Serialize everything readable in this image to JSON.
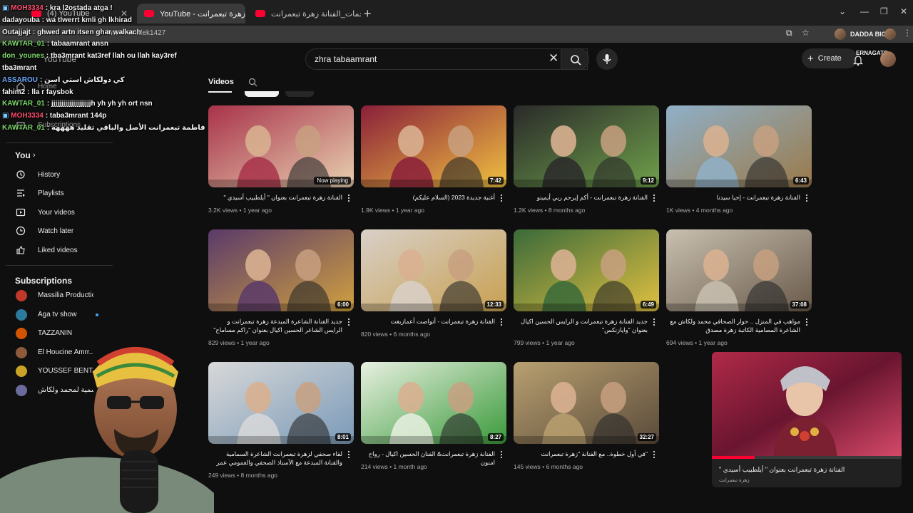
{
  "browser": {
    "tabs": [
      {
        "label": "(4) YouTube",
        "active": false
      },
      {
        "label": "YouTube - زهرة تبعمرانت",
        "active": true
      },
      {
        "label": "مع النجمات_الفنانة زهرة تبعمرانت",
        "active": false
      }
    ],
    "url": "hramossadek1427",
    "profile_name": "DADDA BIGA",
    "profile_name_2": "ERNAGATO"
  },
  "masthead": {
    "logo_text": "YouTube",
    "search_value": "zhra tabaamrant",
    "create_label": "Create"
  },
  "sidebar": {
    "top_items": [
      {
        "label": "Home",
        "icon": "home-icon"
      },
      {
        "label": "Subscriptions",
        "icon": "subscriptions-icon"
      }
    ],
    "you_label": "You",
    "you_items": [
      {
        "label": "History",
        "icon": "history-icon"
      },
      {
        "label": "Playlists",
        "icon": "playlists-icon"
      },
      {
        "label": "Your videos",
        "icon": "your-videos-icon"
      },
      {
        "label": "Watch later",
        "icon": "watch-later-icon"
      },
      {
        "label": "Liked videos",
        "icon": "liked-videos-icon"
      }
    ],
    "subscriptions_label": "Subscriptions",
    "subscriptions": [
      {
        "label": "Massilia Production",
        "color": "#c0392b",
        "live": false
      },
      {
        "label": "Aga tv show",
        "color": "#2c7a9c",
        "live": true
      },
      {
        "label": "TAZZANIN",
        "color": "#d35400",
        "live": false
      },
      {
        "label": "El Houcine Amrr...",
        "color": "#8e5a3c",
        "live": false
      },
      {
        "label": "YOUSSEF BENTA...",
        "color": "#c9a227",
        "live": false
      },
      {
        "label": "الرسمية لمحمد ولكاش",
        "color": "#6b6b9c",
        "live": false
      }
    ]
  },
  "chat": [
    {
      "user": "MOH3334",
      "text": "kra l2ostada atga !",
      "color": "#ff4d6d",
      "badge": true
    },
    {
      "user": "dadayouba",
      "text": "wa tlwerrt kmli gh lkhirad",
      "color": "#f4f4f4",
      "badge": false
    },
    {
      "user": "Outajjajt",
      "text": "ghwed artn itsen ghar walkach",
      "color": "#f4f4f4",
      "badge": false
    },
    {
      "user": "KAWTAR_01",
      "text": "tabaamrant ansn",
      "color": "#7dd96b",
      "badge": false
    },
    {
      "user": "don_younes",
      "text": "tba3mrant kat3ref llah ou llah kay3ref",
      "color": "#7dd96b",
      "badge": false
    },
    {
      "user": "",
      "text": "tba3mrant",
      "color": "#f4f4f4",
      "badge": false
    },
    {
      "user": "ASSAROU",
      "text": "كي دولكاش استي اسن",
      "color": "#6fa8ff",
      "badge": false
    },
    {
      "user": "fahim2",
      "text": "lla r faysbok",
      "color": "#f4f4f4",
      "badge": false
    },
    {
      "user": "KAWTAR_01",
      "text": "jjjjjjjjjjjjjjjjjjjjh yh yh yh ort nsn",
      "color": "#7dd96b",
      "badge": false
    },
    {
      "user": "MOH3334",
      "text": "taba3mrant 144p",
      "color": "#ff4d6d",
      "badge": true
    },
    {
      "user": "KAWTAR_01",
      "text": "فاطمة تبعمرانت الأصل والباقي تقليد ههههه",
      "color": "#7dd96b",
      "badge": false
    }
  ],
  "content": {
    "tab_label": "Videos"
  },
  "videos": [
    {
      "title": "الفنانة زهرة تبعمرانت بعنوان \" أيلطبيب أسيدي \"",
      "views": "3.2K views",
      "age": "1 year ago",
      "badge": "Now playing",
      "now_playing": true,
      "c1": "#a8324a",
      "c2": "#e8d0b0"
    },
    {
      "title": "أغنية جديدة 2023 (السلام عليكم)",
      "views": "1.9K views",
      "age": "1 year ago",
      "badge": "7:42",
      "now_playing": false,
      "c1": "#8a1f3a",
      "c2": "#f0c040"
    },
    {
      "title": "الفنانة زهرة تبعمرانت - أكم إيرحم ربي أيميتو",
      "views": "1.2K views",
      "age": "8 months ago",
      "badge": "9:12",
      "now_playing": false,
      "c1": "#2a2a2a",
      "c2": "#6fa04a"
    },
    {
      "title": "الفنانة زهرة تبعمرانت - إحيا سيدنا",
      "views": "1K views",
      "age": "4 months ago",
      "badge": "6:43",
      "now_playing": false,
      "c1": "#8fb0c8",
      "c2": "#9a7a4a"
    },
    {
      "title": "جديد الفنانة الشاعرة المبدعة زهرة تبعمرانت و الرايس الشاعر الحسين اكيال بعنوان \"راكم مساماح\"",
      "views": "829 views",
      "age": "1 year ago",
      "badge": "6:00",
      "now_playing": false,
      "c1": "#5a3a6a",
      "c2": "#d0a040"
    },
    {
      "title": "الفنانة زهرة تبعمرانت - أتواصت أعمازيغت",
      "views": "820 views",
      "age": "6 months ago",
      "badge": "12:33",
      "now_playing": false,
      "c1": "#d8d0c8",
      "c2": "#c8a050"
    },
    {
      "title": "جديد الفنانة زهرة تبعمرانت و الرايس الحسين اكيال بعنوان \"وايازنكس\"",
      "views": "799 views",
      "age": "1 year ago",
      "badge": "6:49",
      "now_playing": false,
      "c1": "#3a6a3a",
      "c2": "#e0c040"
    },
    {
      "title": "مواهب في المنزل .. حوار الصحافي محمد ولكاش مع الشاعرة المصامية الكاتبة زهرة مصدق",
      "views": "694 views",
      "age": "1 year ago",
      "badge": "37:08",
      "now_playing": false,
      "c1": "#c8c0b0",
      "c2": "#6a5a4a"
    },
    {
      "title": "لقاء صحفي لزهرة تبعمرانت الشاعرة السمامية والفنانة المبدعة مع الأستاذ الصحفي والعمومي عمر الراهي",
      "views": "249 views",
      "age": "8 months ago",
      "badge": "8:01",
      "now_playing": false,
      "c1": "#d8d8d8",
      "c2": "#7a9ab8"
    },
    {
      "title": "الفنانة زهرة تبعمرانت& الفنان الحسين اكيال - رواح امنون",
      "views": "214 views",
      "age": "1 month ago",
      "badge": "8:27",
      "now_playing": false,
      "c1": "#e8f0e0",
      "c2": "#3a9a3a"
    },
    {
      "title": "\"في أول خطوة.. مع الفنانة \"زهرة تبعمرانت",
      "views": "145 views",
      "age": "6 months ago",
      "badge": "32:27",
      "now_playing": false,
      "c1": "#b8a070",
      "c2": "#5a4a3a"
    }
  ],
  "miniplayer": {
    "title": "الفنانة زهرة تبعمرانت بعنوان \" أيلطبيب أسيدي \"",
    "channel": "زهرة تبعمرانت"
  }
}
